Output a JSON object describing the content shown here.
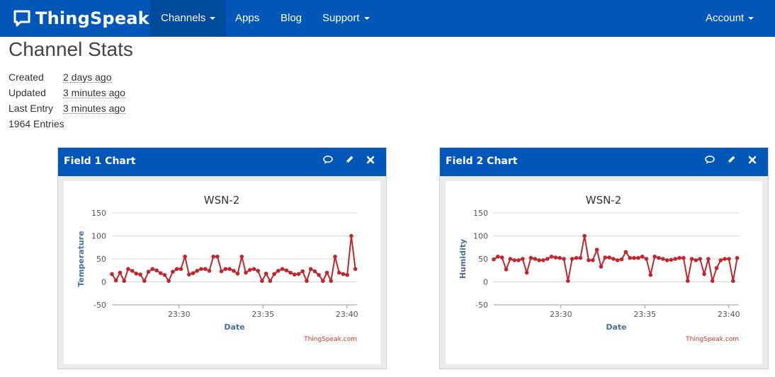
{
  "navbar": {
    "brand": "ThingSpeak",
    "brand_tm": "TM",
    "channels": "Channels",
    "apps": "Apps",
    "blog": "Blog",
    "support": "Support",
    "account": "Account",
    "color": "#0057b8"
  },
  "page": {
    "title": "Channel Stats",
    "created_label": "Created",
    "created_value": "2 days ago",
    "updated_label": "Updated",
    "updated_value": "3 minutes ago",
    "last_entry_label": "Last Entry",
    "last_entry_value": "3 minutes ago",
    "entries": "1964 Entries"
  },
  "panels": [
    {
      "title": "Field 1 Chart",
      "icons": [
        "comment-icon",
        "pencil-icon",
        "close-icon"
      ]
    },
    {
      "title": "Field 2 Chart",
      "icons": [
        "comment-icon",
        "pencil-icon",
        "close-icon"
      ]
    }
  ],
  "chart_data": [
    {
      "type": "line",
      "title": "WSN-2",
      "xlabel": "Date",
      "ylabel": "Temperature",
      "credit": "ThingSpeak.com",
      "ylim": [
        -50,
        150
      ],
      "yticks": [
        "150",
        "100",
        "50",
        "0",
        "-50"
      ],
      "xticks": [
        "23:30",
        "23:35",
        "23:40"
      ],
      "line_color": "#c0272d",
      "grid": true,
      "x_minutes": [
        26.0,
        26.3,
        26.6,
        26.9,
        27.2,
        27.5,
        27.8,
        28.1,
        28.4,
        28.7,
        29.0,
        29.3,
        29.6,
        29.9,
        30.2,
        30.5,
        30.8,
        31.1,
        31.4,
        31.7,
        32.0,
        32.3,
        32.6,
        32.9,
        33.2,
        33.5,
        33.8,
        34.1,
        34.4,
        34.7,
        35.0,
        35.3,
        35.6,
        35.9,
        36.2,
        36.5,
        36.8,
        37.1,
        37.4,
        37.7,
        38.0,
        38.3,
        38.6,
        38.9,
        39.2,
        39.5,
        39.8,
        40.1,
        40.3,
        40.5
      ],
      "values": [
        17,
        3,
        20,
        2,
        28,
        24,
        18,
        16,
        2,
        22,
        28,
        25,
        19,
        15,
        2,
        22,
        28,
        28,
        55,
        16,
        19,
        24,
        28,
        28,
        24,
        55,
        55,
        23,
        28,
        28,
        24,
        18,
        55,
        20,
        26,
        28,
        24,
        2,
        18,
        2,
        17,
        24,
        28,
        25,
        20,
        16,
        17,
        23,
        2,
        28,
        23,
        15,
        2,
        20,
        2,
        55,
        20,
        17,
        15,
        100,
        28
      ]
    },
    {
      "type": "line",
      "title": "WSN-2",
      "xlabel": "Date",
      "ylabel": "Humidity",
      "credit": "ThingSpeak.com",
      "ylim": [
        -50,
        150
      ],
      "yticks": [
        "150",
        "100",
        "50",
        "0",
        "-50"
      ],
      "xticks": [
        "23:30",
        "23:35",
        "23:40"
      ],
      "line_color": "#c0272d",
      "grid": true,
      "values": [
        49,
        55,
        53,
        27,
        50,
        47,
        47,
        50,
        20,
        52,
        50,
        47,
        47,
        50,
        55,
        53,
        52,
        50,
        2,
        50,
        52,
        52,
        100,
        47,
        47,
        70,
        33,
        53,
        53,
        50,
        47,
        49,
        65,
        52,
        52,
        52,
        55,
        50,
        15,
        55,
        52,
        50,
        47,
        48,
        50,
        52,
        52,
        2,
        50,
        47,
        50,
        17,
        50,
        2,
        30,
        47,
        50,
        50,
        2,
        52
      ]
    }
  ]
}
